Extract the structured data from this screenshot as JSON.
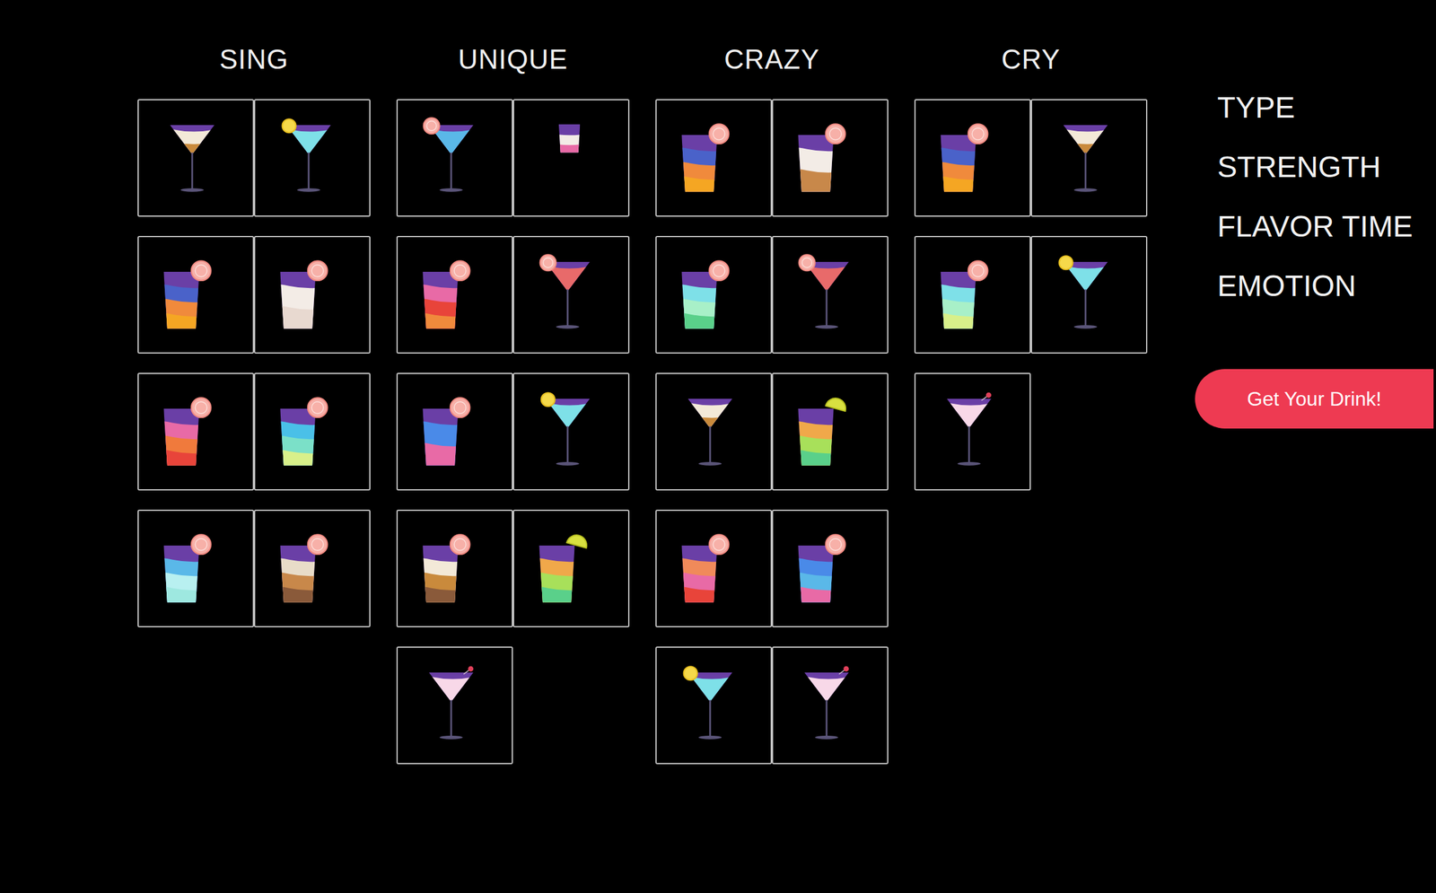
{
  "columns": [
    {
      "title": "SING",
      "drinks": [
        {
          "kind": "martini",
          "colors": [
            "#6a3fa6",
            "#f3e9d8",
            "#c98a3c"
          ],
          "garnish": "none"
        },
        {
          "kind": "martini",
          "colors": [
            "#6a3fa6",
            "#7ee0e8"
          ],
          "garnish": "lemon"
        },
        {
          "kind": "tumbler",
          "colors": [
            "#6a3fa6",
            "#4a62c9",
            "#f08a3c",
            "#f5a623"
          ],
          "garnish": "grapefruit"
        },
        {
          "kind": "tumbler",
          "colors": [
            "#6a3fa6",
            "#f3ece6",
            "#e8d9d0"
          ],
          "garnish": "grapefruit"
        },
        {
          "kind": "tumbler",
          "colors": [
            "#6a3fa6",
            "#e86aa6",
            "#f07a3c",
            "#e8443a"
          ],
          "garnish": "grapefruit"
        },
        {
          "kind": "tumbler",
          "colors": [
            "#6a3fa6",
            "#4ac0e8",
            "#7be0c8",
            "#d8f08a"
          ],
          "garnish": "grapefruit"
        },
        {
          "kind": "tumbler",
          "colors": [
            "#6a3fa6",
            "#5ab8e8",
            "#b8f0f0",
            "#9ee8e0"
          ],
          "garnish": "grapefruit"
        },
        {
          "kind": "tumbler",
          "colors": [
            "#6a3fa6",
            "#e8dcc8",
            "#c8884a",
            "#8a5a3a"
          ],
          "garnish": "grapefruit"
        }
      ]
    },
    {
      "title": "UNIQUE",
      "drinks": [
        {
          "kind": "martini",
          "colors": [
            "#6a3fa6",
            "#5ab8e8"
          ],
          "garnish": "grapefruit"
        },
        {
          "kind": "shot",
          "colors": [
            "#6a3fa6",
            "#f3ece6",
            "#e86aa6"
          ],
          "garnish": "none"
        },
        {
          "kind": "tumbler",
          "colors": [
            "#6a3fa6",
            "#e86aa6",
            "#e8443a",
            "#f08a3c"
          ],
          "garnish": "grapefruit"
        },
        {
          "kind": "martini",
          "colors": [
            "#6a3fa6",
            "#e86a6a"
          ],
          "garnish": "grapefruit"
        },
        {
          "kind": "tumbler",
          "colors": [
            "#6a3fa6",
            "#4a8ae8",
            "#e86aa6"
          ],
          "garnish": "grapefruit"
        },
        {
          "kind": "martini",
          "colors": [
            "#6a3fa6",
            "#7ee0e8"
          ],
          "garnish": "lemon"
        },
        {
          "kind": "tumbler",
          "colors": [
            "#6a3fa6",
            "#f3e9d8",
            "#c98a3c",
            "#8a5a3a"
          ],
          "garnish": "grapefruit"
        },
        {
          "kind": "tumbler",
          "colors": [
            "#6a3fa6",
            "#f0a84a",
            "#a8e05a",
            "#5ad08a"
          ],
          "garnish": "lime"
        },
        {
          "kind": "martini",
          "colors": [
            "#6a3fa6",
            "#f8d8e8"
          ],
          "garnish": "cherry"
        }
      ]
    },
    {
      "title": "CRAZY",
      "drinks": [
        {
          "kind": "tumbler",
          "colors": [
            "#6a3fa6",
            "#4a62c9",
            "#f08a3c",
            "#f5a623"
          ],
          "garnish": "grapefruit"
        },
        {
          "kind": "tumbler",
          "colors": [
            "#6a3fa6",
            "#f3ece6",
            "#c8884a"
          ],
          "garnish": "grapefruit"
        },
        {
          "kind": "tumbler",
          "colors": [
            "#6a3fa6",
            "#7ee0e8",
            "#a8f0c8",
            "#5ad08a"
          ],
          "garnish": "grapefruit"
        },
        {
          "kind": "martini",
          "colors": [
            "#6a3fa6",
            "#e86a6a"
          ],
          "garnish": "grapefruit"
        },
        {
          "kind": "martini",
          "colors": [
            "#6a3fa6",
            "#f3e9d8",
            "#c98a3c"
          ],
          "garnish": "none"
        },
        {
          "kind": "tumbler",
          "colors": [
            "#6a3fa6",
            "#f0a84a",
            "#a8e05a",
            "#5ad08a"
          ],
          "garnish": "lime"
        },
        {
          "kind": "tumbler",
          "colors": [
            "#6a3fa6",
            "#f08a5a",
            "#e86aa6",
            "#e8443a"
          ],
          "garnish": "grapefruit"
        },
        {
          "kind": "tumbler",
          "colors": [
            "#6a3fa6",
            "#4a8ae8",
            "#5ab8e8",
            "#e86aa6"
          ],
          "garnish": "grapefruit"
        },
        {
          "kind": "martini",
          "colors": [
            "#6a3fa6",
            "#7ee0e8"
          ],
          "garnish": "lemon"
        },
        {
          "kind": "martini",
          "colors": [
            "#6a3fa6",
            "#f8d8e8"
          ],
          "garnish": "cherry"
        }
      ]
    },
    {
      "title": "CRY",
      "drinks": [
        {
          "kind": "tumbler",
          "colors": [
            "#6a3fa6",
            "#4a62c9",
            "#f08a3c",
            "#f5a623"
          ],
          "garnish": "grapefruit"
        },
        {
          "kind": "martini",
          "colors": [
            "#6a3fa6",
            "#f3e9d8",
            "#c98a3c"
          ],
          "garnish": "none"
        },
        {
          "kind": "tumbler",
          "colors": [
            "#6a3fa6",
            "#7ee0e8",
            "#a8f0c8",
            "#d8f08a"
          ],
          "garnish": "grapefruit"
        },
        {
          "kind": "martini",
          "colors": [
            "#6a3fa6",
            "#7ee0e8"
          ],
          "garnish": "lemon"
        },
        {
          "kind": "martini",
          "colors": [
            "#6a3fa6",
            "#f8d8e8"
          ],
          "garnish": "cherry"
        }
      ]
    }
  ],
  "filters": [
    {
      "label": "TYPE"
    },
    {
      "label": "STRENGTH"
    },
    {
      "label": "FLAVOR TIME"
    },
    {
      "label": "EMOTION"
    }
  ],
  "button": {
    "label": "Get Your Drink!"
  }
}
